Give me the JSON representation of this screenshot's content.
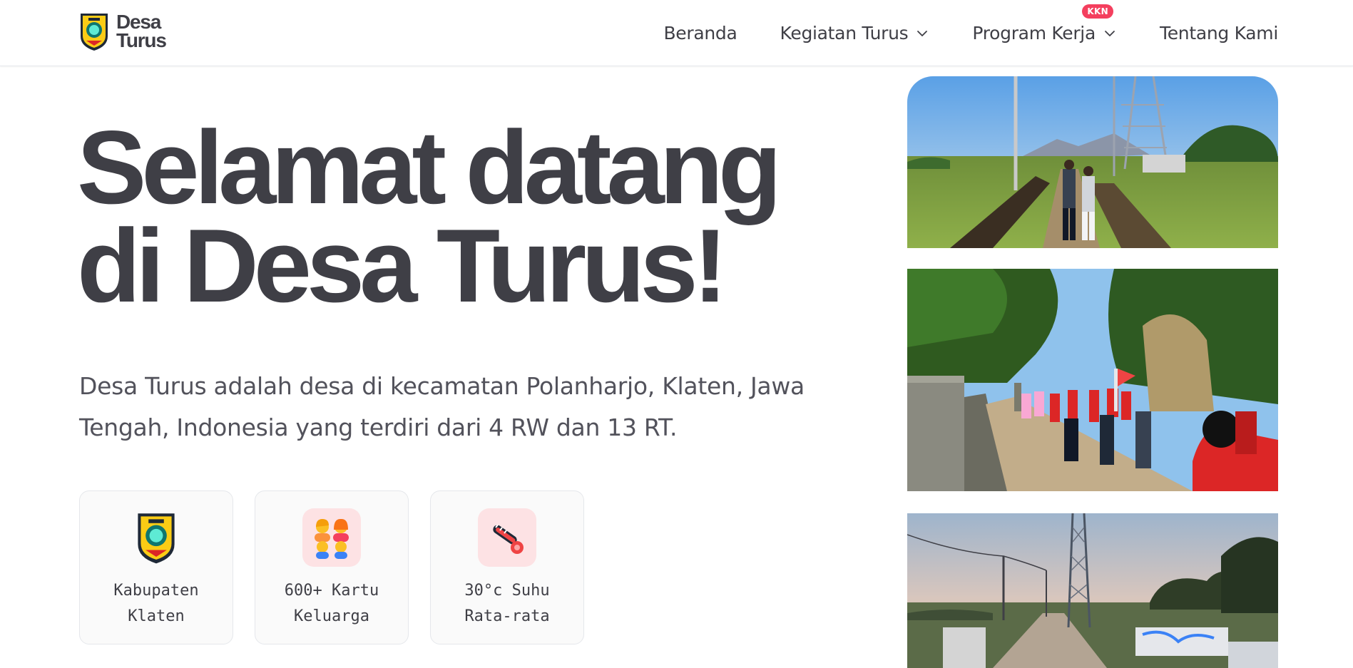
{
  "brand": {
    "line1": "Desa",
    "line2": "Turus",
    "logo_icon": "kabupaten-klaten-emblem"
  },
  "nav": {
    "items": [
      {
        "label": "Beranda",
        "dropdown": false
      },
      {
        "label": "Kegiatan Turus",
        "dropdown": true
      },
      {
        "label": "Program Kerja",
        "dropdown": true,
        "badge": "KKN"
      },
      {
        "label": "Tentang Kami",
        "dropdown": false
      }
    ]
  },
  "hero": {
    "title_line1": "Selamat datang",
    "title_line2_prefix": "di Desa ",
    "title_highlight": "Turus!",
    "description": "Desa Turus adalah desa di kecamatan Polanharjo, Klaten, Jawa Tengah, Indonesia yang terdiri dari 4 RW dan 13 RT."
  },
  "stats": [
    {
      "icon": "kabupaten-emblem-icon",
      "label": "Kabupaten\nKlaten"
    },
    {
      "icon": "family-icon",
      "label": "600+ Kartu\nKeluarga"
    },
    {
      "icon": "thermometer-icon",
      "label": "30°c Suhu\nRata-rata"
    }
  ],
  "photos": [
    {
      "subject": "rice-field-path-with-tower"
    },
    {
      "subject": "village-parade-walk"
    },
    {
      "subject": "sunset-road-with-tower"
    }
  ],
  "colors": {
    "text_dark": "#3f3f46",
    "highlight": "#fcd5d9",
    "badge": "#f43f5e",
    "card_bg": "#fafafa"
  }
}
